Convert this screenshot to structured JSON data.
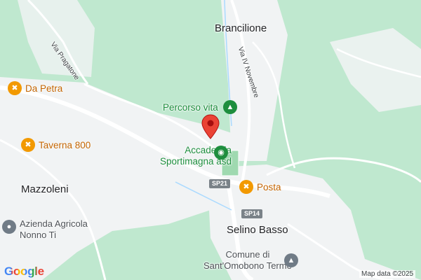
{
  "colors": {
    "background": "#bfe8cf",
    "urban": "#f1f3f4",
    "road": "#ffffff",
    "marker": "#ea4335",
    "food_pin": "#f29900",
    "park_pin": "#1e8e3e",
    "poi_pin": "#707b86"
  },
  "places": {
    "brancilione": "Brancilione",
    "mazzoleni": "Mazzoleni",
    "selino_basso": "Selino Basso"
  },
  "streets": {
    "via_pragatone": "Via Pragatone",
    "via_iv_novembre": "Via IV Novembre"
  },
  "road_shields": {
    "sp21": "SP21",
    "sp14": "SP14"
  },
  "pois": {
    "da_petra": {
      "label": "Da Petra",
      "icon": "fork-knife-icon"
    },
    "taverna_800": {
      "label": "Taverna 800",
      "icon": "fork-knife-icon"
    },
    "posta": {
      "label": "Posta",
      "icon": "fork-knife-icon"
    },
    "percorso_vita": {
      "label": "Percorso vita",
      "icon": "tree-icon"
    },
    "accademia_line1": "Accademia",
    "accademia_line2": "Sportimagna asd",
    "accademia_icon": "stadium-icon",
    "azienda_line1": "Azienda Agricola",
    "azienda_line2": "Nonno Ti",
    "azienda_icon": "place-icon",
    "comune_line1": "Comune di",
    "comune_line2": "Sant'Omobono Terme",
    "comune_icon": "town-hall-icon"
  },
  "marker_icon": "location-pin-icon",
  "logo_text": "Google",
  "attribution": "Map data ©2025"
}
